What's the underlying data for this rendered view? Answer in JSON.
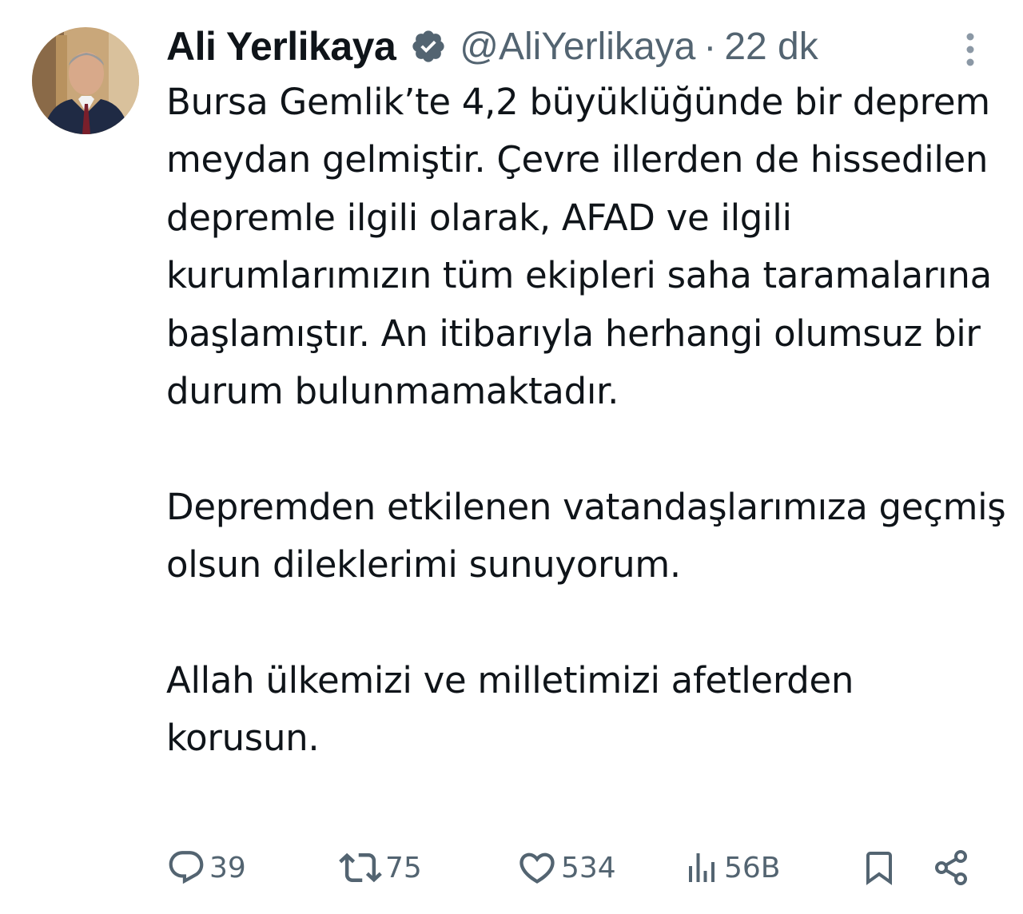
{
  "author": {
    "display_name": "Ali Yerlikaya",
    "handle": "@AliYerlikaya",
    "separator": "·",
    "time_ago": "22 dk",
    "verified": true,
    "verified_color": "#1d9bf0"
  },
  "tweet": {
    "paragraphs": [
      "Bursa Gemlik’te 4,2 büyüklüğünde bir deprem meydan gelmiştir. Çevre illerden de hissedilen depremle ilgili olarak, AFAD ve ilgili kurumlarımızın tüm ekipleri saha taramalarına başlamıştır. An itibarıyla herhangi olumsuz bir durum bulunmamaktadır.",
      "Depremden etkilenen vatandaşlarımıza geçmiş olsun dileklerimi sunuyorum.",
      "Allah ülkemizi ve milletimizi afetlerden korusun."
    ]
  },
  "actions": {
    "replies": "39",
    "retweets": "75",
    "likes": "534",
    "views": "56B"
  },
  "icons": {
    "reply": "reply-icon",
    "retweet": "retweet-icon",
    "like": "heart-icon",
    "views": "views-icon",
    "bookmark": "bookmark-icon",
    "share": "share-icon",
    "more": "more-dots-icon"
  },
  "colors": {
    "text": "#0f1419",
    "muted": "#536471",
    "background": "#ffffff"
  }
}
